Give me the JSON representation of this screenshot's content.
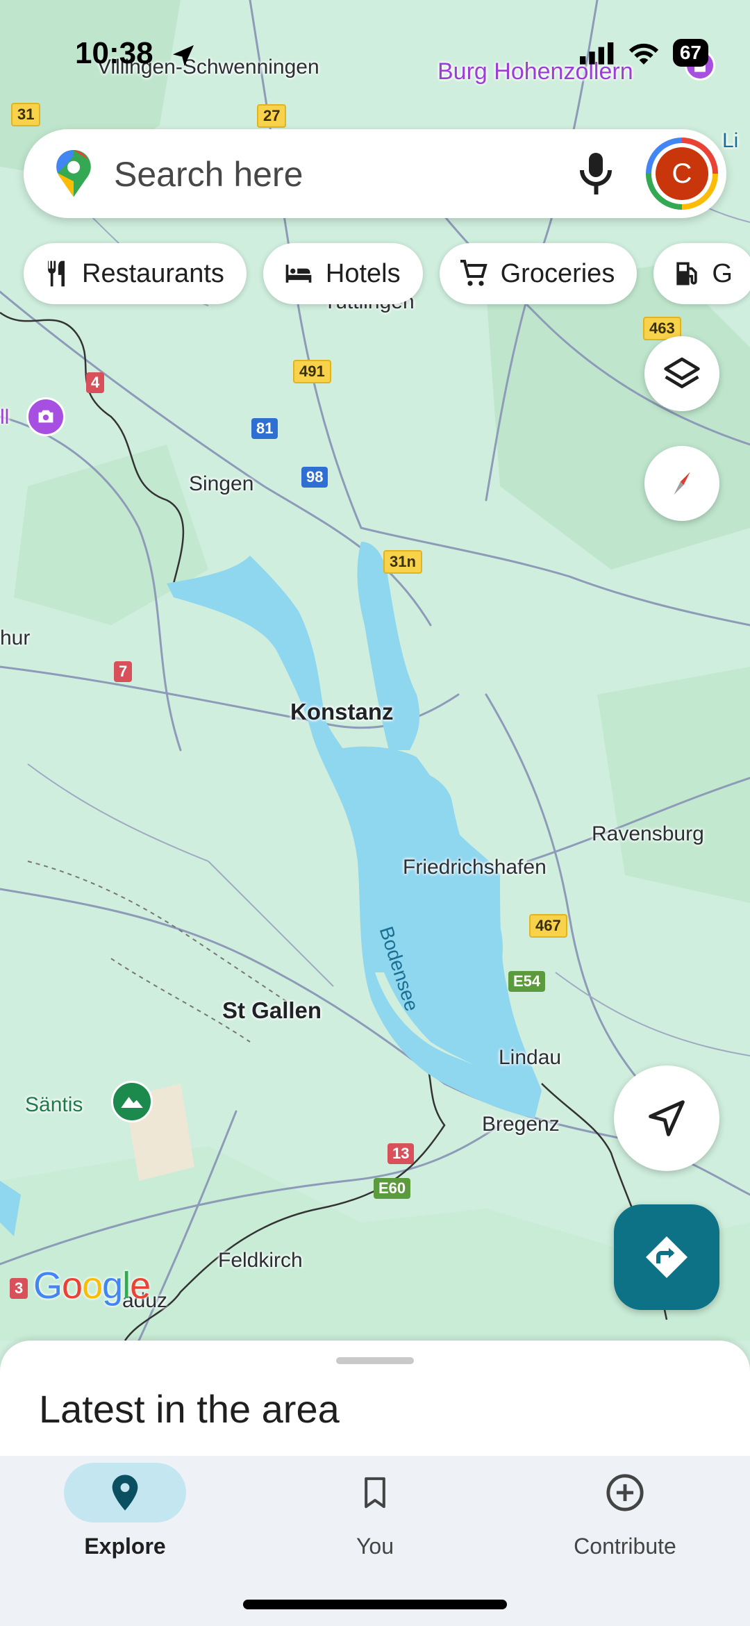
{
  "status_bar": {
    "time": "10:38",
    "battery": "67"
  },
  "search": {
    "placeholder": "Search here",
    "avatar_letter": "C"
  },
  "chips": [
    {
      "label": "Restaurants",
      "icon": "fork-knife-icon"
    },
    {
      "label": "Hotels",
      "icon": "bed-icon"
    },
    {
      "label": "Groceries",
      "icon": "cart-icon"
    },
    {
      "label": "G",
      "icon": "fuel-icon"
    }
  ],
  "map": {
    "places": {
      "villingen": "Villingen-Schwenningen",
      "burg": "Burg Hohenzollern",
      "tuttlingen": "Tuttlingen",
      "singen": "Singen",
      "hur": "hur",
      "konstanz": "Konstanz",
      "ravensburg": "Ravensburg",
      "friedrichshafen": "Friedrichshafen",
      "bodensee": "Bodensee",
      "st_gallen": "St Gallen",
      "lindau": "Lindau",
      "santis": "Säntis",
      "bregenz": "Bregenz",
      "feldkirch": "Feldkirch",
      "vaduz": "aduz",
      "li": "Li",
      "l": "ll"
    },
    "shields": {
      "s31": "31",
      "s27": "27",
      "s463": "463",
      "s491": "491",
      "s4": "4",
      "s81": "81",
      "s98": "98",
      "s31n": "31n",
      "s7": "7",
      "s467": "467",
      "e54": "E54",
      "s13": "13",
      "e60": "E60",
      "s3": "3"
    },
    "colors": {
      "land": "#cfeedd",
      "water": "#8fd6ef",
      "roads": "#8e9bb8"
    }
  },
  "google_logo": "Google",
  "sheet": {
    "title": "Latest in the area"
  },
  "bottom_nav": [
    {
      "label": "Explore",
      "icon": "pin-icon",
      "active": true
    },
    {
      "label": "You",
      "icon": "bookmark-icon",
      "active": false
    },
    {
      "label": "Contribute",
      "icon": "plus-circle-icon",
      "active": false
    }
  ]
}
